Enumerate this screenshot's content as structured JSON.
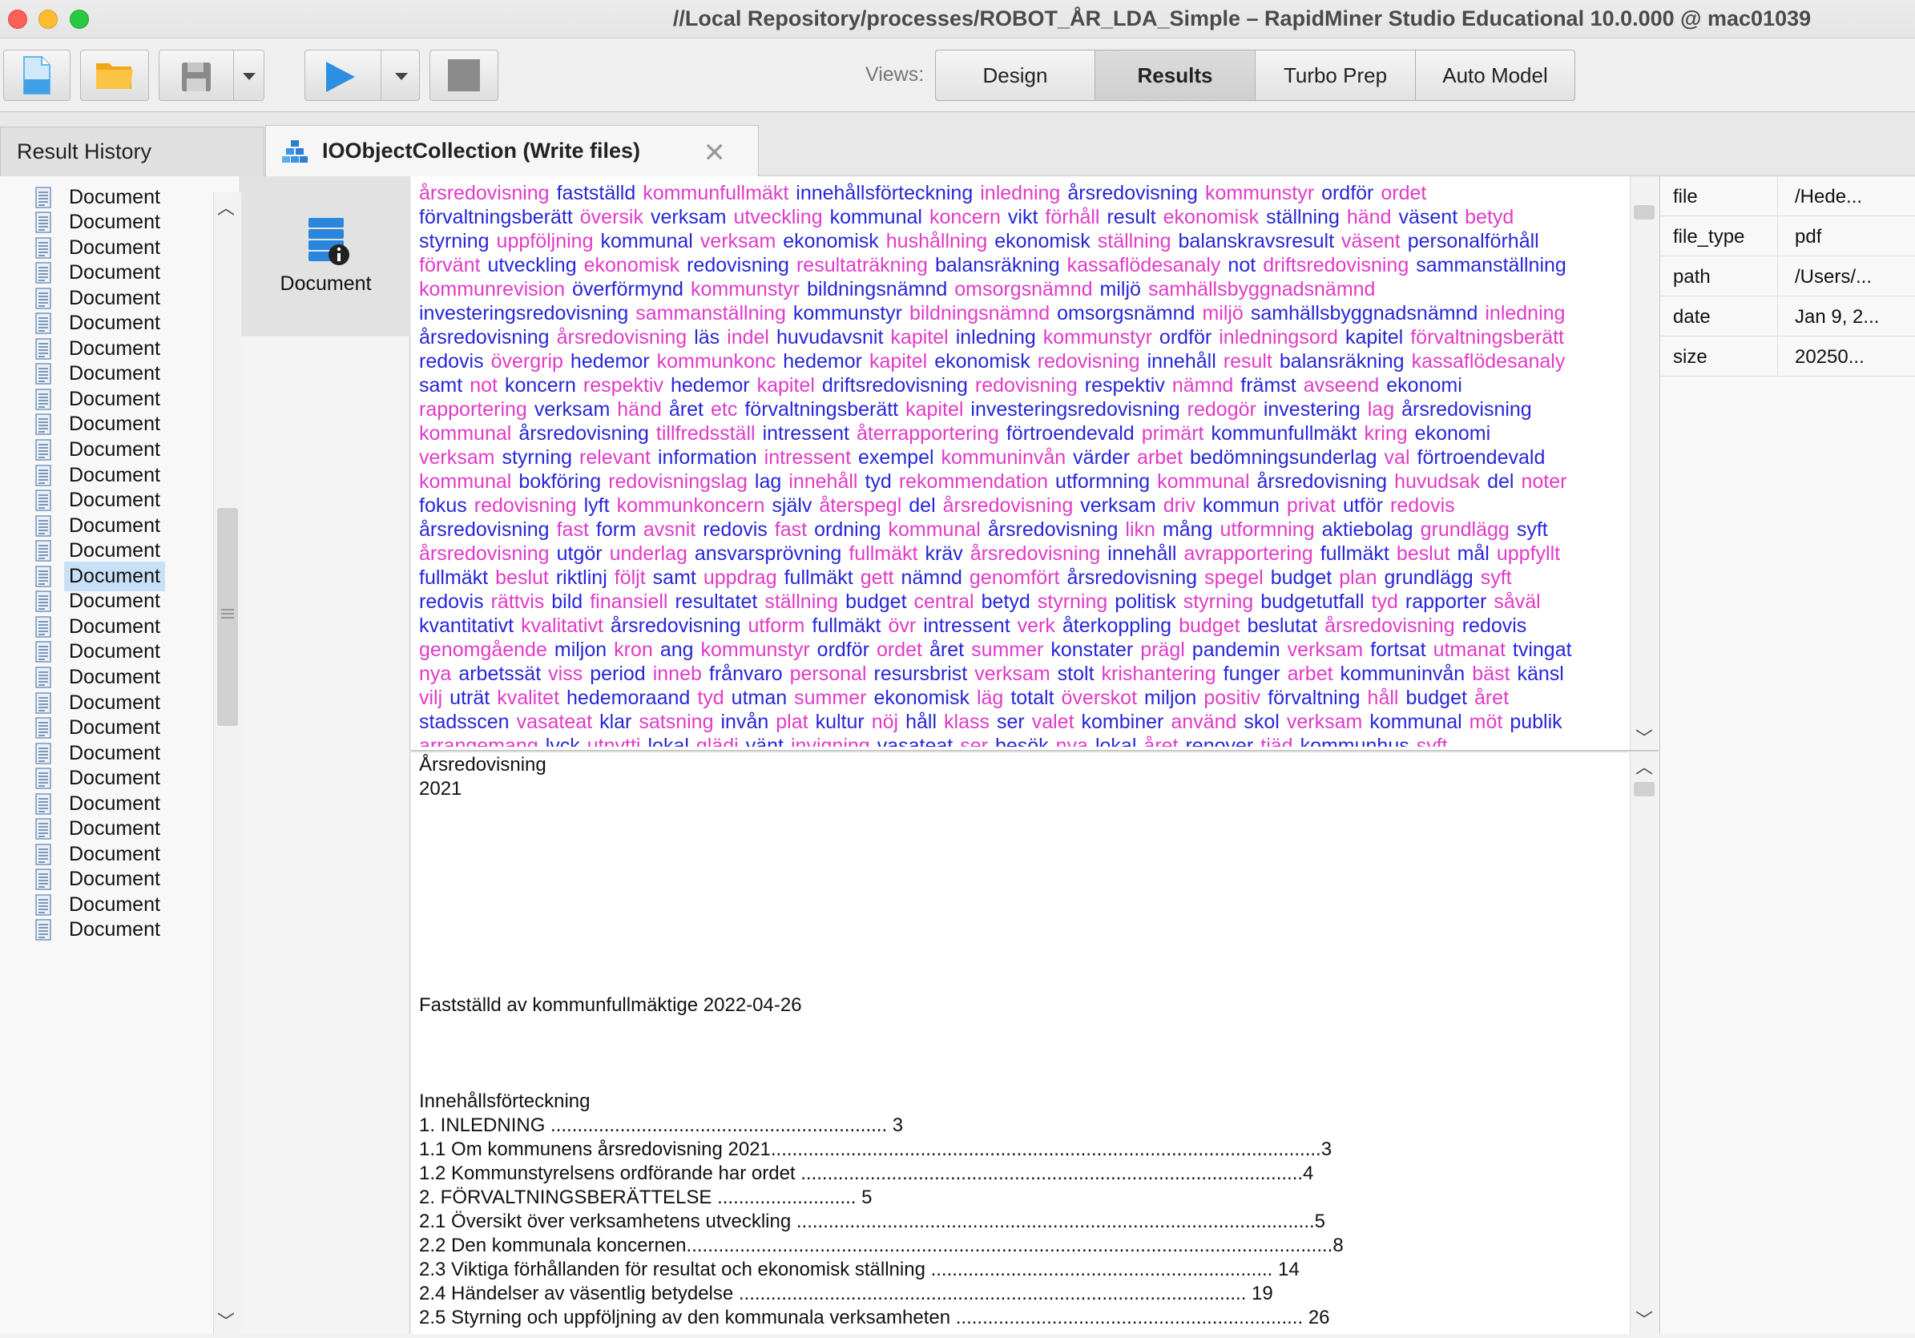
{
  "window": {
    "title": "//Local Repository/processes/ROBOT_ÅR_LDA_Simple – RapidMiner Studio Educational 10.0.000 @ mac01039"
  },
  "toolbar": {
    "views_label": "Views:",
    "views": [
      "Design",
      "Results",
      "Turbo Prep",
      "Auto Model"
    ],
    "active_view": "Results"
  },
  "tabs": {
    "history": "Result History",
    "active": "IOObjectCollection (Write files)"
  },
  "document_list": {
    "item_label": "Document",
    "count": 30,
    "selected_index": 15
  },
  "icon_panel": {
    "label": "Document"
  },
  "wordcloud": [
    [
      [
        "årsredovisning",
        "p"
      ],
      [
        "fastställd",
        "b"
      ],
      [
        "kommunfullmäkt",
        "p"
      ],
      [
        "innehållsförteckning",
        "b"
      ],
      [
        "inledning",
        "p"
      ],
      [
        "årsredovisning",
        "b"
      ],
      [
        "kommunstyr",
        "p"
      ],
      [
        "ordför",
        "b"
      ],
      [
        "ordet",
        "p"
      ]
    ],
    [
      [
        "förvaltningsberätt",
        "b"
      ],
      [
        "översik",
        "p"
      ],
      [
        "verksam",
        "b"
      ],
      [
        "utveckling",
        "p"
      ],
      [
        "kommunal",
        "b"
      ],
      [
        "koncern",
        "p"
      ],
      [
        "vikt",
        "b"
      ],
      [
        "förhåll",
        "p"
      ],
      [
        "result",
        "b"
      ],
      [
        "ekonomisk",
        "p"
      ],
      [
        "ställning",
        "b"
      ],
      [
        "händ",
        "p"
      ],
      [
        "väsent",
        "b"
      ],
      [
        "betyd",
        "p"
      ]
    ],
    [
      [
        "styrning",
        "b"
      ],
      [
        "uppföljning",
        "p"
      ],
      [
        "kommunal",
        "b"
      ],
      [
        "verksam",
        "p"
      ],
      [
        "ekonomisk",
        "b"
      ],
      [
        "hushållning",
        "p"
      ],
      [
        "ekonomisk",
        "b"
      ],
      [
        "ställning",
        "p"
      ],
      [
        "balanskravsresult",
        "b"
      ],
      [
        "väsent",
        "p"
      ],
      [
        "personalförhåll",
        "b"
      ]
    ],
    [
      [
        "förvänt",
        "p"
      ],
      [
        "utveckling",
        "b"
      ],
      [
        "ekonomisk",
        "p"
      ],
      [
        "redovisning",
        "b"
      ],
      [
        "resultaträkning",
        "p"
      ],
      [
        "balansräkning",
        "b"
      ],
      [
        "kassaflödesanaly",
        "p"
      ],
      [
        "not",
        "b"
      ],
      [
        "driftsredovisning",
        "p"
      ],
      [
        "sammanställning",
        "b"
      ]
    ],
    [
      [
        "kommunrevision",
        "p"
      ],
      [
        "överförmynd",
        "b"
      ],
      [
        "kommunstyr",
        "p"
      ],
      [
        "bildningsnämnd",
        "b"
      ],
      [
        "omsorgsnämnd",
        "p"
      ],
      [
        "miljö",
        "b"
      ],
      [
        "samhällsbyggnadsnämnd",
        "p"
      ]
    ],
    [
      [
        "investeringsredovisning",
        "b"
      ],
      [
        "sammanställning",
        "p"
      ],
      [
        "kommunstyr",
        "b"
      ],
      [
        "bildningsnämnd",
        "p"
      ],
      [
        "omsorgsnämnd",
        "b"
      ],
      [
        "miljö",
        "p"
      ],
      [
        "samhällsbyggnadsnämnd",
        "b"
      ],
      [
        "inledning",
        "p"
      ]
    ],
    [
      [
        "årsredovisning",
        "b"
      ],
      [
        "årsredovisning",
        "p"
      ],
      [
        "läs",
        "b"
      ],
      [
        "indel",
        "p"
      ],
      [
        "huvudavsnit",
        "b"
      ],
      [
        "kapitel",
        "p"
      ],
      [
        "inledning",
        "b"
      ],
      [
        "kommunstyr",
        "p"
      ],
      [
        "ordför",
        "b"
      ],
      [
        "inledningsord",
        "p"
      ],
      [
        "kapitel",
        "b"
      ],
      [
        "förvaltningsberätt",
        "p"
      ]
    ],
    [
      [
        "redovis",
        "b"
      ],
      [
        "övergrip",
        "p"
      ],
      [
        "hedemor",
        "b"
      ],
      [
        "kommunkonc",
        "p"
      ],
      [
        "hedemor",
        "b"
      ],
      [
        "kapitel",
        "p"
      ],
      [
        "ekonomisk",
        "b"
      ],
      [
        "redovisning",
        "p"
      ],
      [
        "innehåll",
        "b"
      ],
      [
        "result",
        "p"
      ],
      [
        "balansräkning",
        "b"
      ],
      [
        "kassaflödesanaly",
        "p"
      ]
    ],
    [
      [
        "samt",
        "b"
      ],
      [
        "not",
        "p"
      ],
      [
        "koncern",
        "b"
      ],
      [
        "respektiv",
        "p"
      ],
      [
        "hedemor",
        "b"
      ],
      [
        "kapitel",
        "p"
      ],
      [
        "driftsredovisning",
        "b"
      ],
      [
        "redovisning",
        "p"
      ],
      [
        "respektiv",
        "b"
      ],
      [
        "nämnd",
        "p"
      ],
      [
        "främst",
        "b"
      ],
      [
        "avseend",
        "p"
      ],
      [
        "ekonomi",
        "b"
      ]
    ],
    [
      [
        "rapportering",
        "p"
      ],
      [
        "verksam",
        "b"
      ],
      [
        "händ",
        "p"
      ],
      [
        "året",
        "b"
      ],
      [
        "etc",
        "p"
      ],
      [
        "förvaltningsberätt",
        "b"
      ],
      [
        "kapitel",
        "p"
      ],
      [
        "investeringsredovisning",
        "b"
      ],
      [
        "redogör",
        "p"
      ],
      [
        "investering",
        "b"
      ],
      [
        "lag",
        "p"
      ],
      [
        "årsredovisning",
        "b"
      ]
    ],
    [
      [
        "kommunal",
        "p"
      ],
      [
        "årsredovisning",
        "b"
      ],
      [
        "tillfredsställ",
        "p"
      ],
      [
        "intressent",
        "b"
      ],
      [
        "återrapportering",
        "p"
      ],
      [
        "förtroendevald",
        "b"
      ],
      [
        "primärt",
        "p"
      ],
      [
        "kommunfullmäkt",
        "b"
      ],
      [
        "kring",
        "p"
      ],
      [
        "ekonomi",
        "b"
      ]
    ],
    [
      [
        "verksam",
        "p"
      ],
      [
        "styrning",
        "b"
      ],
      [
        "relevant",
        "p"
      ],
      [
        "information",
        "b"
      ],
      [
        "intressent",
        "p"
      ],
      [
        "exempel",
        "b"
      ],
      [
        "kommuninvån",
        "p"
      ],
      [
        "värder",
        "b"
      ],
      [
        "arbet",
        "p"
      ],
      [
        "bedömningsunderlag",
        "b"
      ],
      [
        "val",
        "p"
      ],
      [
        "förtroendevald",
        "b"
      ]
    ],
    [
      [
        "kommunal",
        "p"
      ],
      [
        "bokföring",
        "b"
      ],
      [
        "redovisningslag",
        "p"
      ],
      [
        "lag",
        "b"
      ],
      [
        "innehåll",
        "p"
      ],
      [
        "tyd",
        "b"
      ],
      [
        "rekommendation",
        "p"
      ],
      [
        "utformning",
        "b"
      ],
      [
        "kommunal",
        "p"
      ],
      [
        "årsredovisning",
        "b"
      ],
      [
        "huvudsak",
        "p"
      ],
      [
        "del",
        "b"
      ],
      [
        "noter",
        "p"
      ]
    ],
    [
      [
        "fokus",
        "b"
      ],
      [
        "redovisning",
        "p"
      ],
      [
        "lyft",
        "b"
      ],
      [
        "kommunkoncern",
        "p"
      ],
      [
        "själv",
        "b"
      ],
      [
        "återspegl",
        "p"
      ],
      [
        "del",
        "b"
      ],
      [
        "årsredovisning",
        "p"
      ],
      [
        "verksam",
        "b"
      ],
      [
        "driv",
        "p"
      ],
      [
        "kommun",
        "b"
      ],
      [
        "privat",
        "p"
      ],
      [
        "utför",
        "b"
      ],
      [
        "redovis",
        "p"
      ]
    ],
    [
      [
        "årsredovisning",
        "b"
      ],
      [
        "fast",
        "p"
      ],
      [
        "form",
        "b"
      ],
      [
        "avsnit",
        "p"
      ],
      [
        "redovis",
        "b"
      ],
      [
        "fast",
        "p"
      ],
      [
        "ordning",
        "b"
      ],
      [
        "kommunal",
        "p"
      ],
      [
        "årsredovisning",
        "b"
      ],
      [
        "likn",
        "p"
      ],
      [
        "mång",
        "b"
      ],
      [
        "utformning",
        "p"
      ],
      [
        "aktiebolag",
        "b"
      ],
      [
        "grundlägg",
        "p"
      ],
      [
        "syft",
        "b"
      ]
    ],
    [
      [
        "årsredovisning",
        "p"
      ],
      [
        "utgör",
        "b"
      ],
      [
        "underlag",
        "p"
      ],
      [
        "ansvarsprövning",
        "b"
      ],
      [
        "fullmäkt",
        "p"
      ],
      [
        "kräv",
        "b"
      ],
      [
        "årsredovisning",
        "p"
      ],
      [
        "innehåll",
        "b"
      ],
      [
        "avrapportering",
        "p"
      ],
      [
        "fullmäkt",
        "b"
      ],
      [
        "beslut",
        "p"
      ],
      [
        "mål",
        "b"
      ],
      [
        "uppfyllt",
        "p"
      ]
    ],
    [
      [
        "fullmäkt",
        "b"
      ],
      [
        "beslut",
        "p"
      ],
      [
        "riktlinj",
        "b"
      ],
      [
        "följt",
        "p"
      ],
      [
        "samt",
        "b"
      ],
      [
        "uppdrag",
        "p"
      ],
      [
        "fullmäkt",
        "b"
      ],
      [
        "gett",
        "p"
      ],
      [
        "nämnd",
        "b"
      ],
      [
        "genomfört",
        "p"
      ],
      [
        "årsredovisning",
        "b"
      ],
      [
        "spegel",
        "p"
      ],
      [
        "budget",
        "b"
      ],
      [
        "plan",
        "p"
      ],
      [
        "grundlägg",
        "b"
      ],
      [
        "syft",
        "p"
      ]
    ],
    [
      [
        "redovis",
        "b"
      ],
      [
        "rättvis",
        "p"
      ],
      [
        "bild",
        "b"
      ],
      [
        "finansiell",
        "p"
      ],
      [
        "resultatet",
        "b"
      ],
      [
        "ställning",
        "p"
      ],
      [
        "budget",
        "b"
      ],
      [
        "central",
        "p"
      ],
      [
        "betyd",
        "b"
      ],
      [
        "styrning",
        "p"
      ],
      [
        "politisk",
        "b"
      ],
      [
        "styrning",
        "p"
      ],
      [
        "budgetutfall",
        "b"
      ],
      [
        "tyd",
        "p"
      ],
      [
        "rapporter",
        "b"
      ],
      [
        "såväl",
        "p"
      ]
    ],
    [
      [
        "kvantitativt",
        "b"
      ],
      [
        "kvalitativt",
        "p"
      ],
      [
        "årsredovisning",
        "b"
      ],
      [
        "utform",
        "p"
      ],
      [
        "fullmäkt",
        "b"
      ],
      [
        "övr",
        "p"
      ],
      [
        "intressent",
        "b"
      ],
      [
        "verk",
        "p"
      ],
      [
        "återkoppling",
        "b"
      ],
      [
        "budget",
        "p"
      ],
      [
        "beslutat",
        "b"
      ],
      [
        "årsredovisning",
        "p"
      ],
      [
        "redovis",
        "b"
      ]
    ],
    [
      [
        "genomgående",
        "p"
      ],
      [
        "miljon",
        "b"
      ],
      [
        "kron",
        "p"
      ],
      [
        "ang",
        "b"
      ],
      [
        "kommunstyr",
        "p"
      ],
      [
        "ordför",
        "b"
      ],
      [
        "ordet",
        "p"
      ],
      [
        "året",
        "b"
      ],
      [
        "summer",
        "p"
      ],
      [
        "konstater",
        "b"
      ],
      [
        "prägl",
        "p"
      ],
      [
        "pandemin",
        "b"
      ],
      [
        "verksam",
        "p"
      ],
      [
        "fortsat",
        "b"
      ],
      [
        "utmanat",
        "p"
      ],
      [
        "tvingat",
        "b"
      ]
    ],
    [
      [
        "nya",
        "p"
      ],
      [
        "arbetssät",
        "b"
      ],
      [
        "viss",
        "p"
      ],
      [
        "period",
        "b"
      ],
      [
        "inneb",
        "p"
      ],
      [
        "frånvaro",
        "b"
      ],
      [
        "personal",
        "p"
      ],
      [
        "resursbrist",
        "b"
      ],
      [
        "verksam",
        "p"
      ],
      [
        "stolt",
        "b"
      ],
      [
        "krishantering",
        "p"
      ],
      [
        "funger",
        "b"
      ],
      [
        "arbet",
        "p"
      ],
      [
        "kommuninvån",
        "b"
      ],
      [
        "bäst",
        "p"
      ],
      [
        "känsl",
        "b"
      ]
    ],
    [
      [
        "vilj",
        "p"
      ],
      [
        "uträt",
        "b"
      ],
      [
        "kvalitet",
        "p"
      ],
      [
        "hedemoraand",
        "b"
      ],
      [
        "tyd",
        "p"
      ],
      [
        "utman",
        "b"
      ],
      [
        "summer",
        "p"
      ],
      [
        "ekonomisk",
        "b"
      ],
      [
        "läg",
        "p"
      ],
      [
        "totalt",
        "b"
      ],
      [
        "överskot",
        "p"
      ],
      [
        "miljon",
        "b"
      ],
      [
        "positiv",
        "p"
      ],
      [
        "förvaltning",
        "b"
      ],
      [
        "håll",
        "p"
      ],
      [
        "budget",
        "b"
      ],
      [
        "året",
        "p"
      ]
    ],
    [
      [
        "stadsscen",
        "b"
      ],
      [
        "vasateat",
        "p"
      ],
      [
        "klar",
        "b"
      ],
      [
        "satsning",
        "p"
      ],
      [
        "invån",
        "b"
      ],
      [
        "plat",
        "p"
      ],
      [
        "kultur",
        "b"
      ],
      [
        "nöj",
        "p"
      ],
      [
        "håll",
        "b"
      ],
      [
        "klass",
        "p"
      ],
      [
        "ser",
        "b"
      ],
      [
        "valet",
        "p"
      ],
      [
        "kombiner",
        "b"
      ],
      [
        "använd",
        "p"
      ],
      [
        "skol",
        "b"
      ],
      [
        "verksam",
        "p"
      ],
      [
        "kommunal",
        "b"
      ],
      [
        "möt",
        "p"
      ],
      [
        "publik",
        "b"
      ]
    ],
    [
      [
        "arrangemang",
        "p"
      ],
      [
        "lyck",
        "b"
      ],
      [
        "utnytti",
        "p"
      ],
      [
        "lokal",
        "b"
      ],
      [
        "glädi",
        "p"
      ],
      [
        "vänt",
        "b"
      ],
      [
        "invigning",
        "p"
      ],
      [
        "vasateat",
        "b"
      ],
      [
        "ser",
        "p"
      ],
      [
        "besök",
        "b"
      ],
      [
        "nya",
        "p"
      ],
      [
        "lokal",
        "b"
      ],
      [
        "året",
        "p"
      ],
      [
        "renover",
        "b"
      ],
      [
        "tiäd",
        "p"
      ],
      [
        "kommunhus",
        "b"
      ],
      [
        "syft",
        "p"
      ]
    ]
  ],
  "document_text": [
    "Årsredovisning",
    "2021",
    "",
    "",
    "",
    "",
    "",
    "",
    "",
    "",
    "Fastställd av kommunfullmäktige 2022-04-26",
    "",
    "",
    "",
    "Innehållsförteckning",
    "1. INLEDNING ............................................................... 3",
    "1.1 Om kommunens årsredovisning 2021.......................................................................................................3",
    "1.2 Kommunstyrelsens ordförande har ordet ..............................................................................................4",
    "2. FÖRVALTNINGSBERÄTTELSE .......................... 5",
    "2.1 Översikt över verksamhetens utveckling .................................................................................................5",
    "2.2 Den kommunala koncernen.........................................................................................................................8",
    "2.3 Viktiga förhållanden för resultat och ekonomisk ställning ................................................................ 14",
    "2.4 Händelser av väsentlig betydelse ............................................................................................... 19",
    "2.5 Styrning och uppföljning av den kommunala verksamheten ................................................................. 26"
  ],
  "metadata": [
    {
      "key": "file",
      "value": "/Hede..."
    },
    {
      "key": "file_type",
      "value": "pdf"
    },
    {
      "key": "path",
      "value": "/Users/..."
    },
    {
      "key": "date",
      "value": "Jan 9, 2..."
    },
    {
      "key": "size",
      "value": "20250..."
    }
  ],
  "colors": {
    "word_pink": "#e03bc8",
    "word_blue": "#2727d8",
    "selection": "#c8e0f6"
  },
  "icons": {
    "new": "new-process-icon",
    "open": "folder-icon",
    "save": "floppy-disk-icon",
    "run": "play-icon",
    "stop": "stop-icon",
    "collection": "collection-icon",
    "document": "document-icon",
    "doc_info": "document-info-icon"
  }
}
